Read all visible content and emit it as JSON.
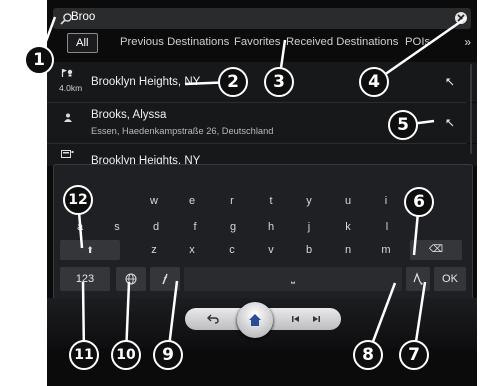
{
  "search": {
    "text": "Broo"
  },
  "tabs": {
    "all": "All",
    "items": [
      "Previous Destinations",
      "Favorites",
      "Received Destinations",
      "POIs"
    ],
    "more": "»"
  },
  "results": [
    {
      "icon": "destination-flag-icon",
      "distance": "4.0km",
      "title": "Brooklyn Heights, NY",
      "subtitle": ""
    },
    {
      "icon": "contact-icon",
      "distance": "",
      "title": "Brooks, Alyssa",
      "subtitle": "Essen, Haedenkampstraße 26, Deutschland"
    },
    {
      "icon": "poi-icon",
      "distance": "",
      "title": "Brooklyn Heights, NY",
      "subtitle": ""
    }
  ],
  "keyboard": {
    "row1": [
      "w",
      "e",
      "r",
      "t",
      "y",
      "u",
      "i",
      "o"
    ],
    "row2": [
      "a",
      "s",
      "d",
      "f",
      "g",
      "h",
      "j",
      "k",
      "l"
    ],
    "row3": [
      "z",
      "x",
      "c",
      "v",
      "b",
      "n",
      "m"
    ],
    "shift": "⬆",
    "backspace": "⌫",
    "numbers": "123",
    "space": "⎵",
    "ok": "OK"
  },
  "callouts": [
    "1",
    "2",
    "3",
    "4",
    "5",
    "6",
    "7",
    "8",
    "9",
    "10",
    "11",
    "12"
  ]
}
